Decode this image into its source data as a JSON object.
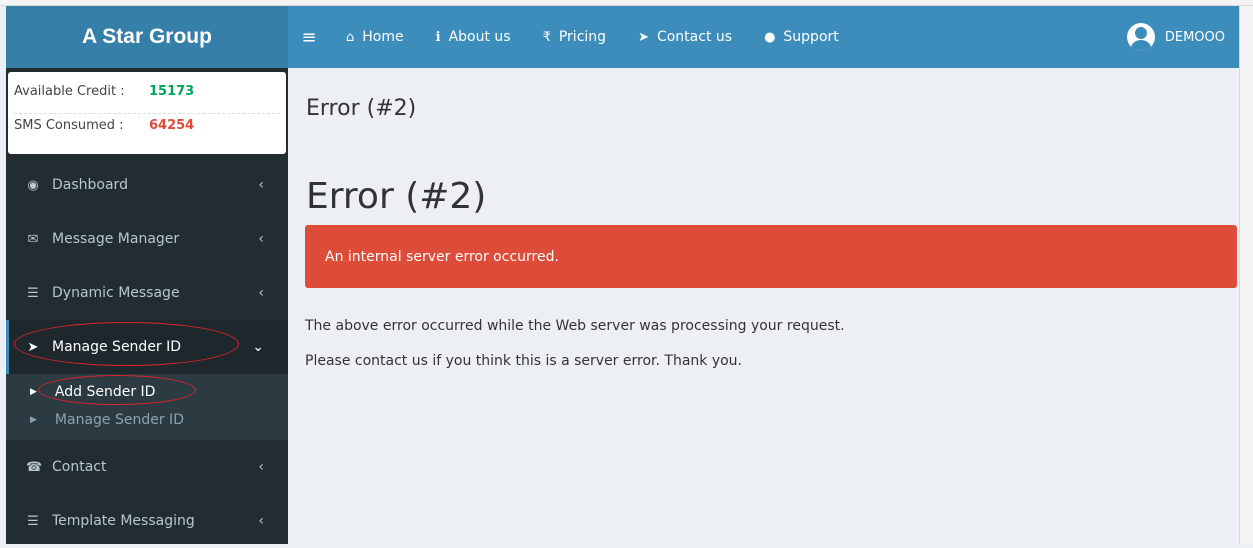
{
  "brand": "A Star Group",
  "nav": {
    "items": [
      {
        "icon": "home-icon",
        "glyph": "⌂",
        "label": "Home"
      },
      {
        "icon": "info-icon",
        "glyph": "i",
        "label": "About us"
      },
      {
        "icon": "rupee-icon",
        "glyph": "₹",
        "label": "Pricing"
      },
      {
        "icon": "paper-plane-icon",
        "glyph": "➤",
        "label": "Contact us"
      },
      {
        "icon": "comment-icon",
        "glyph": "●",
        "label": "Support"
      }
    ],
    "user": "DEMOOO"
  },
  "credits": {
    "available_label": "Available Credit :",
    "available_value": "15173",
    "available_color": "#00a65a",
    "consumed_label": "SMS Consumed :",
    "consumed_value": "64254",
    "consumed_color": "#dd4b39"
  },
  "sidebar": {
    "items": [
      {
        "label": "Dashboard",
        "icon": "dashboard-icon",
        "glyph": "◉"
      },
      {
        "label": "Message Manager",
        "icon": "envelope-icon",
        "glyph": "✉"
      },
      {
        "label": "Dynamic Message",
        "icon": "server-icon",
        "glyph": "☰"
      },
      {
        "label": "Manage Sender ID",
        "icon": "paper-plane-icon",
        "glyph": "➤"
      },
      {
        "label": "Contact",
        "icon": "phone-icon",
        "glyph": "☎"
      },
      {
        "label": "Template Messaging",
        "icon": "server-icon",
        "glyph": "☰"
      }
    ],
    "submenu": [
      {
        "label": "Add Sender ID"
      },
      {
        "label": "Manage Sender ID"
      }
    ]
  },
  "content": {
    "page_title": "Error (#2)",
    "heading": "Error (#2)",
    "alert": "An internal server error occurred.",
    "line1": "The above error occurred while the Web server was processing your request.",
    "line2": "Please contact us if you think this is a server error. Thank you."
  }
}
